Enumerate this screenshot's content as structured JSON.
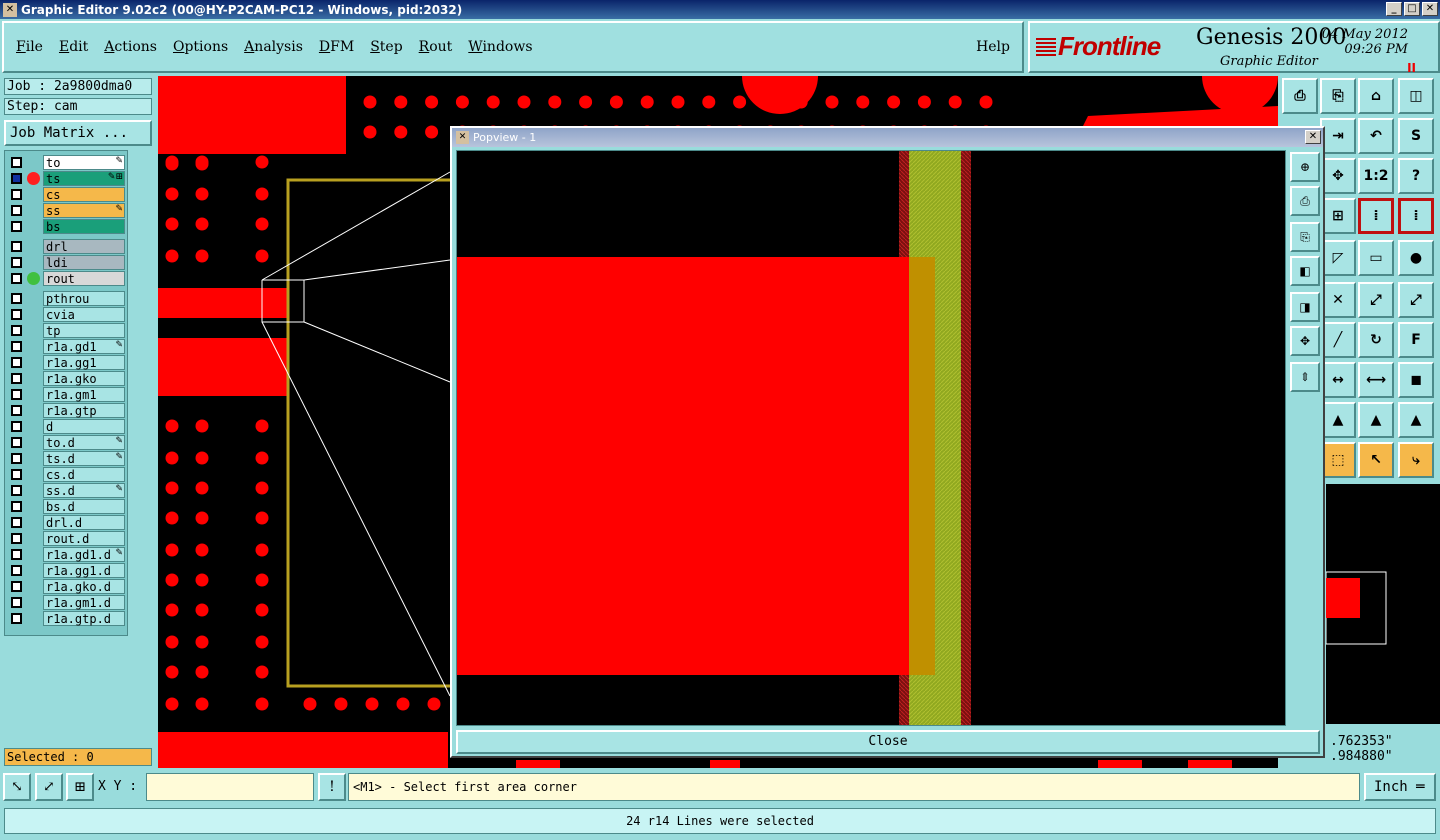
{
  "window": {
    "title": "Graphic Editor 9.02c2 (00@HY-P2CAM-PC12 - Windows, pid:2032)",
    "minimize": "_",
    "maximize": "□",
    "close": "✕"
  },
  "menu": {
    "items": [
      "File",
      "Edit",
      "Actions",
      "Options",
      "Analysis",
      "DFM",
      "Step",
      "Rout",
      "Windows"
    ],
    "help": "Help"
  },
  "brand": {
    "logo": "Frontline",
    "product": "Genesis 2000",
    "subtitle": "Graphic Editor",
    "date": "04 May 2012",
    "time": "09:26 PM",
    "pause": "II"
  },
  "job": {
    "job": "Job : 2a9800dma0",
    "step": "Step: cam",
    "matrix_button": "Job Matrix ...",
    "selected": "Selected : 0"
  },
  "layers": [
    {
      "name": "to",
      "color": "#ffffff",
      "dot": "",
      "flag": "✎"
    },
    {
      "name": "ts",
      "color": "#1a9f7a",
      "dot": "#ff2020",
      "flag": "✎⊞",
      "work": true
    },
    {
      "name": "cs",
      "color": "#f5b84a",
      "dot": "",
      "flag": ""
    },
    {
      "name": "ss",
      "color": "#f5b84a",
      "dot": "",
      "flag": "✎"
    },
    {
      "name": "bs",
      "color": "#1a9f7a",
      "dot": "",
      "flag": ""
    },
    {
      "name": "drl",
      "color": "#a8b8c0",
      "dot": "",
      "flag": ""
    },
    {
      "name": "ldi",
      "color": "#a8b8c0",
      "dot": "",
      "flag": ""
    },
    {
      "name": "rout",
      "color": "#d8d8d8",
      "dot": "#40c040",
      "flag": ""
    },
    {
      "name": "pthrou",
      "color": "#a8e4e4",
      "dot": "",
      "flag": ""
    },
    {
      "name": "cvia",
      "color": "#a8e4e4",
      "dot": "",
      "flag": ""
    },
    {
      "name": "tp",
      "color": "#a8e4e4",
      "dot": "",
      "flag": ""
    },
    {
      "name": "r1a.gd1",
      "color": "#a8e4e4",
      "dot": "",
      "flag": "✎"
    },
    {
      "name": "r1a.gg1",
      "color": "#a8e4e4",
      "dot": "",
      "flag": ""
    },
    {
      "name": "r1a.gko",
      "color": "#a8e4e4",
      "dot": "",
      "flag": ""
    },
    {
      "name": "r1a.gm1",
      "color": "#a8e4e4",
      "dot": "",
      "flag": ""
    },
    {
      "name": "r1a.gtp",
      "color": "#a8e4e4",
      "dot": "",
      "flag": ""
    },
    {
      "name": "d",
      "color": "#a8e4e4",
      "dot": "",
      "flag": ""
    },
    {
      "name": "to.d",
      "color": "#a8e4e4",
      "dot": "",
      "flag": "✎"
    },
    {
      "name": "ts.d",
      "color": "#a8e4e4",
      "dot": "",
      "flag": "✎"
    },
    {
      "name": "cs.d",
      "color": "#a8e4e4",
      "dot": "",
      "flag": ""
    },
    {
      "name": "ss.d",
      "color": "#a8e4e4",
      "dot": "",
      "flag": "✎"
    },
    {
      "name": "bs.d",
      "color": "#a8e4e4",
      "dot": "",
      "flag": ""
    },
    {
      "name": "drl.d",
      "color": "#a8e4e4",
      "dot": "",
      "flag": ""
    },
    {
      "name": "rout.d",
      "color": "#a8e4e4",
      "dot": "",
      "flag": ""
    },
    {
      "name": "r1a.gd1.d",
      "color": "#a8e4e4",
      "dot": "",
      "flag": "✎"
    },
    {
      "name": "r1a.gg1.d",
      "color": "#a8e4e4",
      "dot": "",
      "flag": ""
    },
    {
      "name": "r1a.gko.d",
      "color": "#a8e4e4",
      "dot": "",
      "flag": ""
    },
    {
      "name": "r1a.gm1.d",
      "color": "#a8e4e4",
      "dot": "",
      "flag": ""
    },
    {
      "name": "r1a.gtp.d",
      "color": "#a8e4e4",
      "dot": "",
      "flag": ""
    }
  ],
  "popview": {
    "title": "Popview - 1",
    "close_label": "Close"
  },
  "coords": {
    "x": ".762353\"",
    "y": ".984880\""
  },
  "bottom": {
    "xy_label": "X Y :",
    "xy_value": "",
    "excl": "!",
    "prompt": "<M1> - Select first area corner",
    "unit": "Inch ═",
    "status": "24 r14 Lines were selected"
  },
  "colors": {
    "feature_red": "#ff0000",
    "profile_yellow": "#b8a020",
    "olive": "#a0b020",
    "panel_cyan": "#99dcdc"
  }
}
